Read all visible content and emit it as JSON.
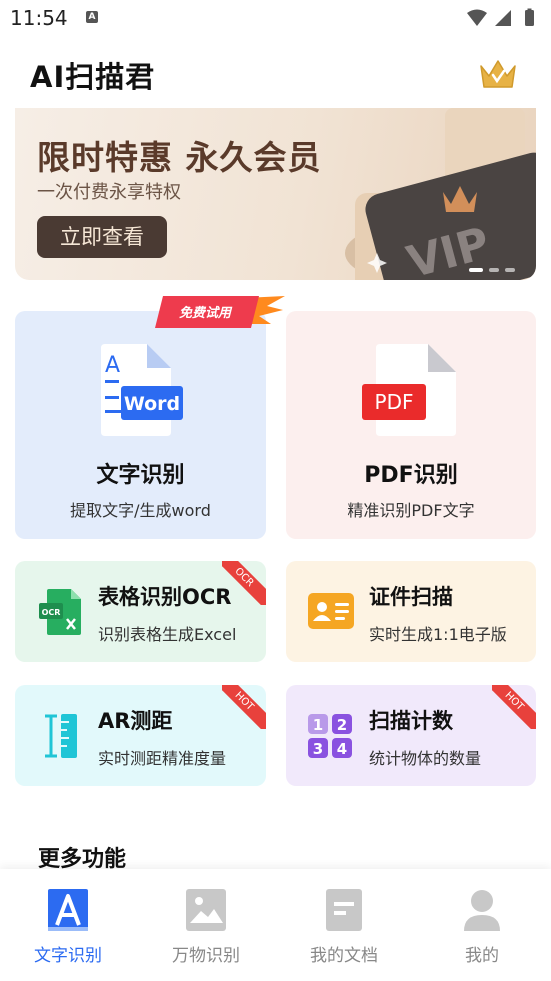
{
  "status_bar": {
    "time": "11:54",
    "notif_icon": "A"
  },
  "header": {
    "title": "AI扫描君",
    "vip_icon": "crown-icon"
  },
  "banner": {
    "title": "限时特惠 永久会员",
    "subtitle": "一次付费永享特权",
    "button": "立即查看",
    "card_text": "VIP",
    "page_count": 3,
    "active_page": 1
  },
  "free_badge": "免费试用",
  "features": {
    "text_recognition": {
      "title": "文字识别",
      "subtitle": "提取文字/生成word",
      "icon_letter": "A",
      "icon_label": "Word"
    },
    "pdf_recognition": {
      "title": "PDF识别",
      "subtitle": "精准识别PDF文字",
      "icon_label": "PDF"
    },
    "table_ocr": {
      "title": "表格识别OCR",
      "subtitle": "识别表格生成Excel",
      "icon_label": "OCR",
      "ribbon": "OCR"
    },
    "id_scan": {
      "title": "证件扫描",
      "subtitle": "实时生成1:1电子版"
    },
    "ar_measure": {
      "title": "AR测距",
      "subtitle": "实时测距精准度量",
      "ribbon": "HOT"
    },
    "scan_count": {
      "title": "扫描计数",
      "subtitle": "统计物体的数量",
      "ribbon": "HOT",
      "digits": [
        "1",
        "2",
        "3",
        "4"
      ]
    }
  },
  "more_title": "更多功能",
  "bottom_nav": [
    {
      "label": "文字识别",
      "icon": "text-recognition-icon",
      "active": true
    },
    {
      "label": "万物识别",
      "icon": "image-icon",
      "active": false
    },
    {
      "label": "我的文档",
      "icon": "document-icon",
      "active": false
    },
    {
      "label": "我的",
      "icon": "user-icon",
      "active": false
    }
  ],
  "colors": {
    "accent": "#2c6bf1",
    "hot": "#e8413c",
    "banner_text": "#5a3a2a"
  }
}
